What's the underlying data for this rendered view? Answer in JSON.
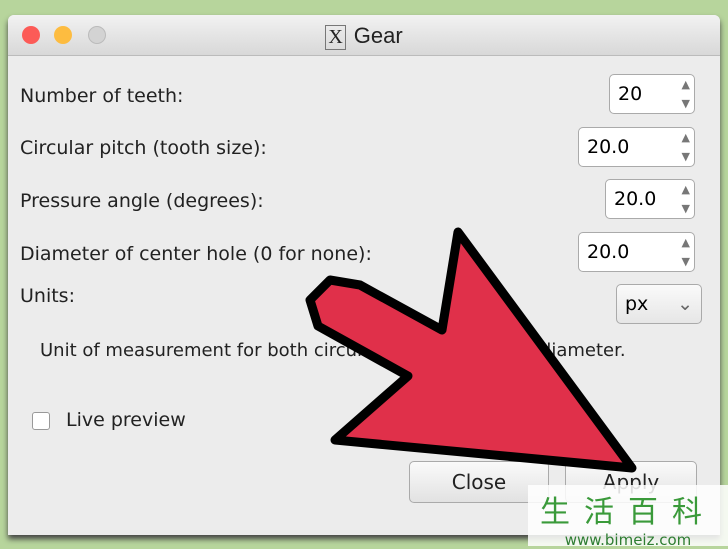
{
  "window": {
    "title": "Gear",
    "title_icon": "x11-icon"
  },
  "fields": [
    {
      "label": "Number of teeth:",
      "value": "20"
    },
    {
      "label": "Circular pitch (tooth size):",
      "value": "20.0"
    },
    {
      "label": "Pressure angle (degrees):",
      "value": "20.0"
    },
    {
      "label": "Diameter of center hole (0 for none):",
      "value": "20.0"
    }
  ],
  "units": {
    "label": "Units:",
    "value": "px",
    "description": "Unit of measurement for both circular pitch and center diameter."
  },
  "live_preview": {
    "label": "Live preview",
    "checked": false
  },
  "buttons": {
    "close": "Close",
    "apply": "Apply"
  },
  "overlay": {
    "arrow_color": "#e0304a"
  },
  "watermark": {
    "chars": "生活百科",
    "url": "www.bimeiz.com"
  }
}
